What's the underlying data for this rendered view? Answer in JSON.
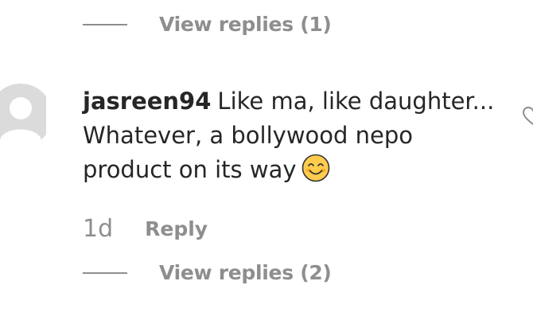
{
  "top_thread": {
    "view_replies_label": "View replies (1)"
  },
  "comment": {
    "username": "jasreen94",
    "text": "Like ma, like daughter... Whatever, a bollywood nepo product on its way",
    "emoji": "smiling-face-with-smiling-eyes",
    "time": "1d",
    "reply_label": "Reply",
    "view_replies_label": "View replies (2)",
    "like_icon": "heart-outline"
  },
  "colors": {
    "text": "#262626",
    "muted": "#8e8e8e",
    "avatar_bg": "#dbdbdb",
    "emoji_fill": "#ffcc4d"
  }
}
